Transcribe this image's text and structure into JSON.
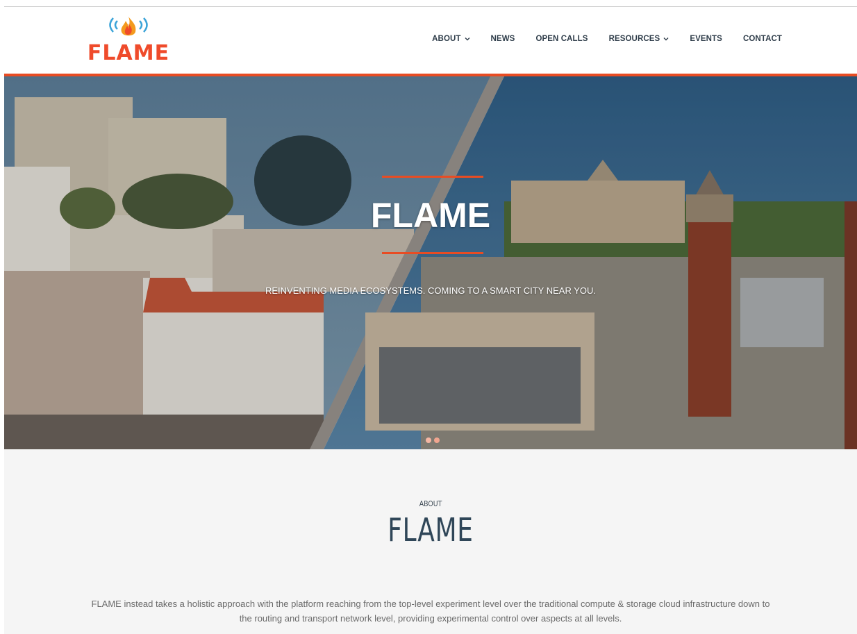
{
  "logo": {
    "text": "FLAME"
  },
  "nav": {
    "items": [
      {
        "label": "ABOUT",
        "has_dropdown": true
      },
      {
        "label": "NEWS",
        "has_dropdown": false
      },
      {
        "label": "OPEN CALLS",
        "has_dropdown": false
      },
      {
        "label": "RESOURCES",
        "has_dropdown": true
      },
      {
        "label": "EVENTS",
        "has_dropdown": false
      },
      {
        "label": "CONTACT",
        "has_dropdown": false
      }
    ]
  },
  "hero": {
    "title": "FLAME",
    "subtitle": "REINVENTING MEDIA ECOSYSTEMS. COMING TO A SMART CITY NEAR YOU.",
    "slides_count": 2,
    "active_slide": 1
  },
  "about": {
    "kicker": "ABOUT",
    "title": "FLAME",
    "text": "FLAME instead takes a holistic approach with the platform reaching from the top-level experiment level over the traditional compute & storage cloud infrastructure down to the routing and transport network level, providing experimental control over aspects at all levels."
  },
  "colors": {
    "accent": "#e84c23",
    "nav_text": "#2f3d4a",
    "about_title": "#2f4658",
    "about_bg": "#f5f5f5"
  },
  "icons": [
    "flame-logo-icon",
    "chevron-down-icon"
  ]
}
